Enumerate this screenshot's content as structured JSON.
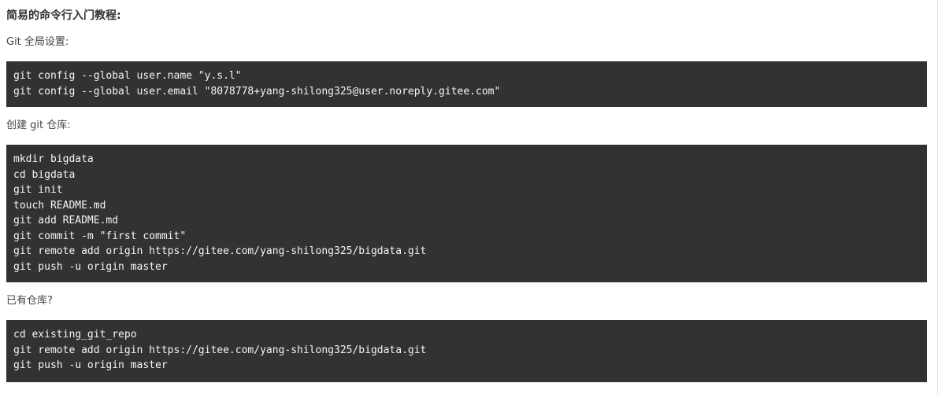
{
  "section": {
    "title": "简易的命令行入门教程:"
  },
  "global_setup": {
    "label": "Git 全局设置:",
    "lines": [
      "git config --global user.name \"y.s.l\"",
      "git config --global user.email \"8078778+yang-shilong325@user.noreply.gitee.com\""
    ]
  },
  "create_repo": {
    "label": "创建 git 仓库:",
    "lines": [
      "mkdir bigdata",
      "cd bigdata",
      "git init",
      "touch README.md",
      "git add README.md",
      "git commit -m \"first commit\"",
      "git remote add origin https://gitee.com/yang-shilong325/bigdata.git",
      "git push -u origin master"
    ]
  },
  "existing_repo": {
    "label": "已有仓库?",
    "lines": [
      "cd existing_git_repo",
      "git remote add origin https://gitee.com/yang-shilong325/bigdata.git",
      "git push -u origin master"
    ]
  }
}
